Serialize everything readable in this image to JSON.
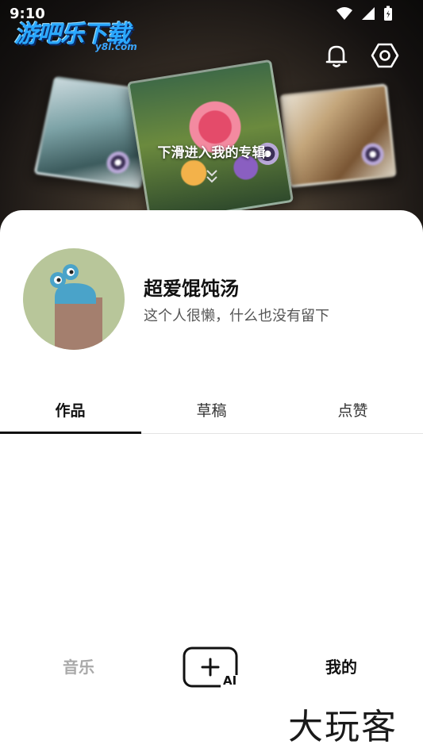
{
  "status_bar": {
    "time": "9:10"
  },
  "watermark_logo": {
    "text": "游吧乐下载",
    "sub": "y8l.com"
  },
  "header": {
    "hint": "下滑进入我的专辑",
    "icons": [
      "bell-icon",
      "settings-icon",
      "chevrons-down-icon"
    ]
  },
  "profile": {
    "name": "超爱馄饨汤",
    "bio": "这个人很懒，什么也没有留下"
  },
  "tabs": [
    {
      "label": "作品",
      "active": true
    },
    {
      "label": "草稿",
      "active": false
    },
    {
      "label": "点赞",
      "active": false
    }
  ],
  "bottom_nav": {
    "music": "音乐",
    "create": "AI",
    "mine": "我的"
  },
  "watermark_bottom": "大玩客",
  "colors": {
    "accent_text": "#111111",
    "inactive_nav": "#a9a9a9",
    "hero_dark": "#0b0a09"
  }
}
